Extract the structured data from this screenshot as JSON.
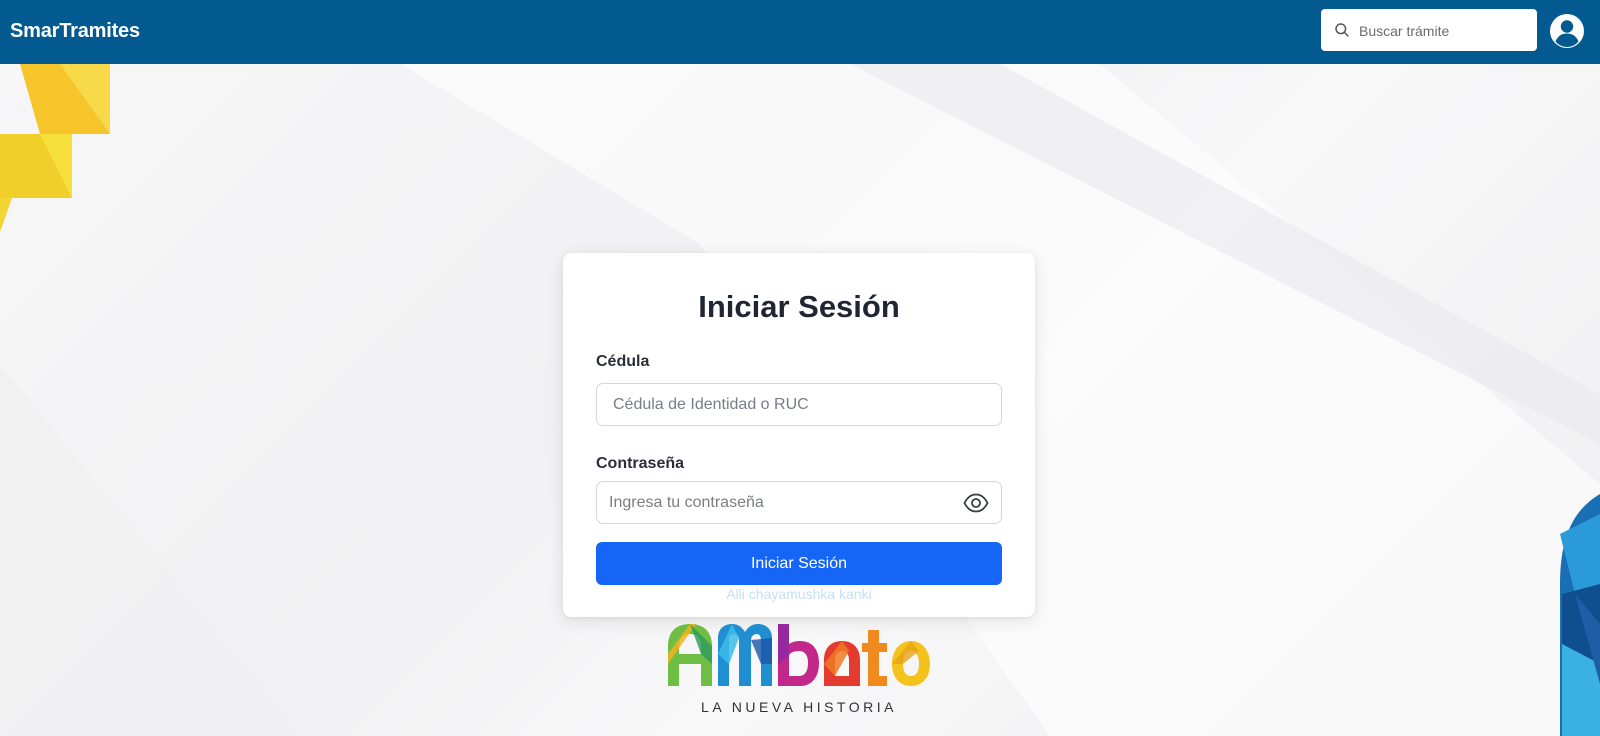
{
  "app": {
    "brand": "SmarTramites"
  },
  "header": {
    "search_placeholder": "Buscar trámite",
    "search_icon": "search-icon",
    "avatar_icon": "user-circle-icon"
  },
  "login": {
    "title": "Iniciar Sesión",
    "cedula_label": "Cédula",
    "cedula_placeholder": "Cédula de Identidad o RUC",
    "password_label": "Contraseña",
    "password_placeholder": "Ingresa tu contraseña",
    "show_password_icon": "eye-icon",
    "submit_label": "Iniciar Sesión",
    "subtext": "Alli chayamushka kanki"
  },
  "logo": {
    "name": "Ambato",
    "tagline": "LA NUEVA HISTORIA"
  },
  "colors": {
    "header_bg": "#025a91",
    "primary_button": "#1565f7",
    "title_text": "#1f2533"
  }
}
